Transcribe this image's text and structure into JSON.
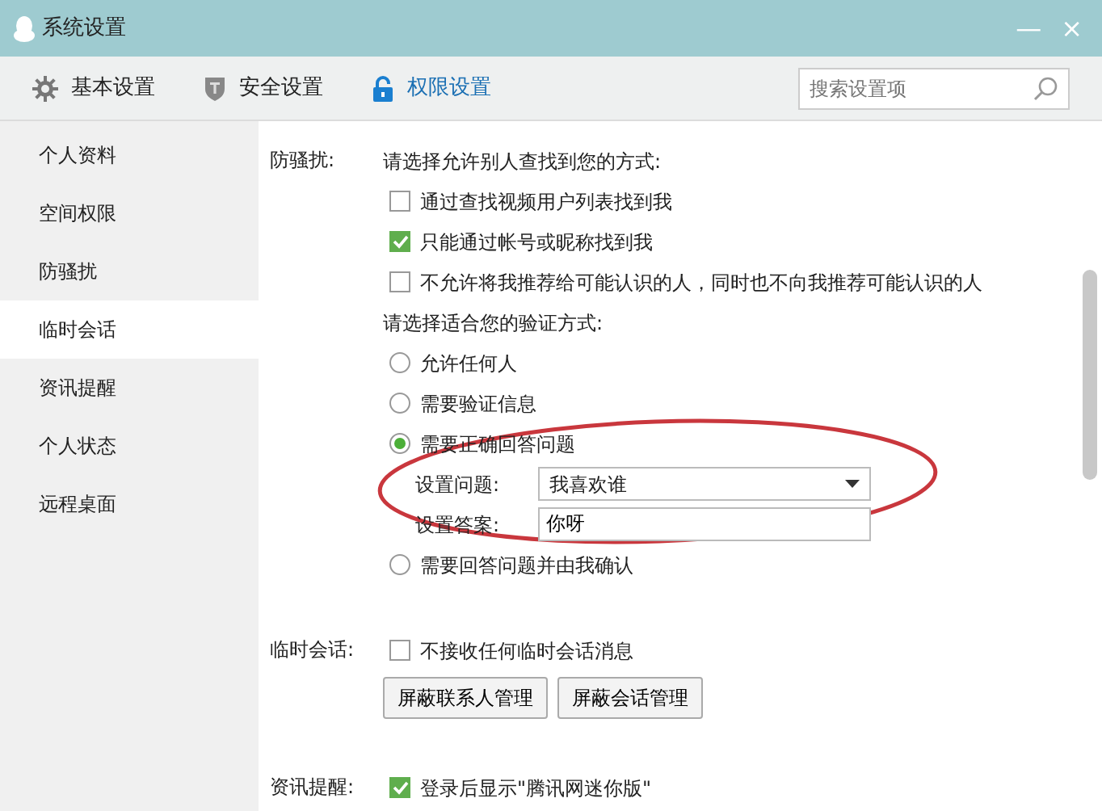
{
  "window": {
    "title": "系统设置",
    "buttons": [
      "—",
      "×"
    ]
  },
  "toolbar": {
    "tabs": [
      {
        "label": "基本设置",
        "selected": false
      },
      {
        "label": "安全设置",
        "selected": false
      },
      {
        "label": "权限设置",
        "selected": true
      }
    ],
    "search": {
      "placeholder": "搜索设置项"
    }
  },
  "sidebar": {
    "items": [
      {
        "label": "个人资料",
        "selected": false
      },
      {
        "label": "空间权限",
        "selected": false
      },
      {
        "label": "防骚扰",
        "selected": false
      },
      {
        "label": "临时会话",
        "selected": true
      },
      {
        "label": "资讯提醒",
        "selected": false
      },
      {
        "label": "个人状态",
        "selected": false
      },
      {
        "label": "远程桌面",
        "selected": false
      }
    ]
  },
  "sections": [
    {
      "label": "防骚扰:",
      "rows": [
        {
          "kind": "heading",
          "text": "请选择允许别人查找到您的方式:"
        },
        {
          "kind": "checkbox",
          "text": "通过查找视频用户列表找到我",
          "checked": false
        },
        {
          "kind": "checkbox",
          "text": "只能通过帐号或昵称找到我",
          "checked": true
        },
        {
          "kind": "checkbox",
          "text": "不允许将我推荐给可能认识的人，同时也不向我推荐可能认识的人",
          "checked": false
        },
        {
          "kind": "heading",
          "text": "请选择适合您的验证方式:"
        },
        {
          "kind": "radio",
          "text": "允许任何人",
          "selected": false
        },
        {
          "kind": "radio",
          "text": "需要验证信息",
          "selected": false
        },
        {
          "kind": "radio",
          "text": "需要正确回答问题",
          "selected": true
        },
        {
          "kind": "select",
          "label": "设置问题:",
          "value": "我喜欢谁"
        },
        {
          "kind": "text",
          "label": "设置答案:",
          "value": "你呀"
        },
        {
          "kind": "radio",
          "text": "需要回答问题并由我确认",
          "selected": false
        }
      ]
    },
    {
      "label": "临时会话:",
      "rows": [
        {
          "kind": "checkbox",
          "text": "不接收任何临时会话消息",
          "checked": false
        },
        {
          "kind": "buttons",
          "buttons": [
            "屏蔽联系人管理",
            "屏蔽会话管理"
          ]
        }
      ]
    },
    {
      "label": "资讯提醒:",
      "rows": [
        {
          "kind": "checkbox",
          "text": "登录后显示\"腾讯网迷你版\"",
          "checked": true
        }
      ]
    }
  ],
  "annotation": {
    "ellipse": true
  }
}
